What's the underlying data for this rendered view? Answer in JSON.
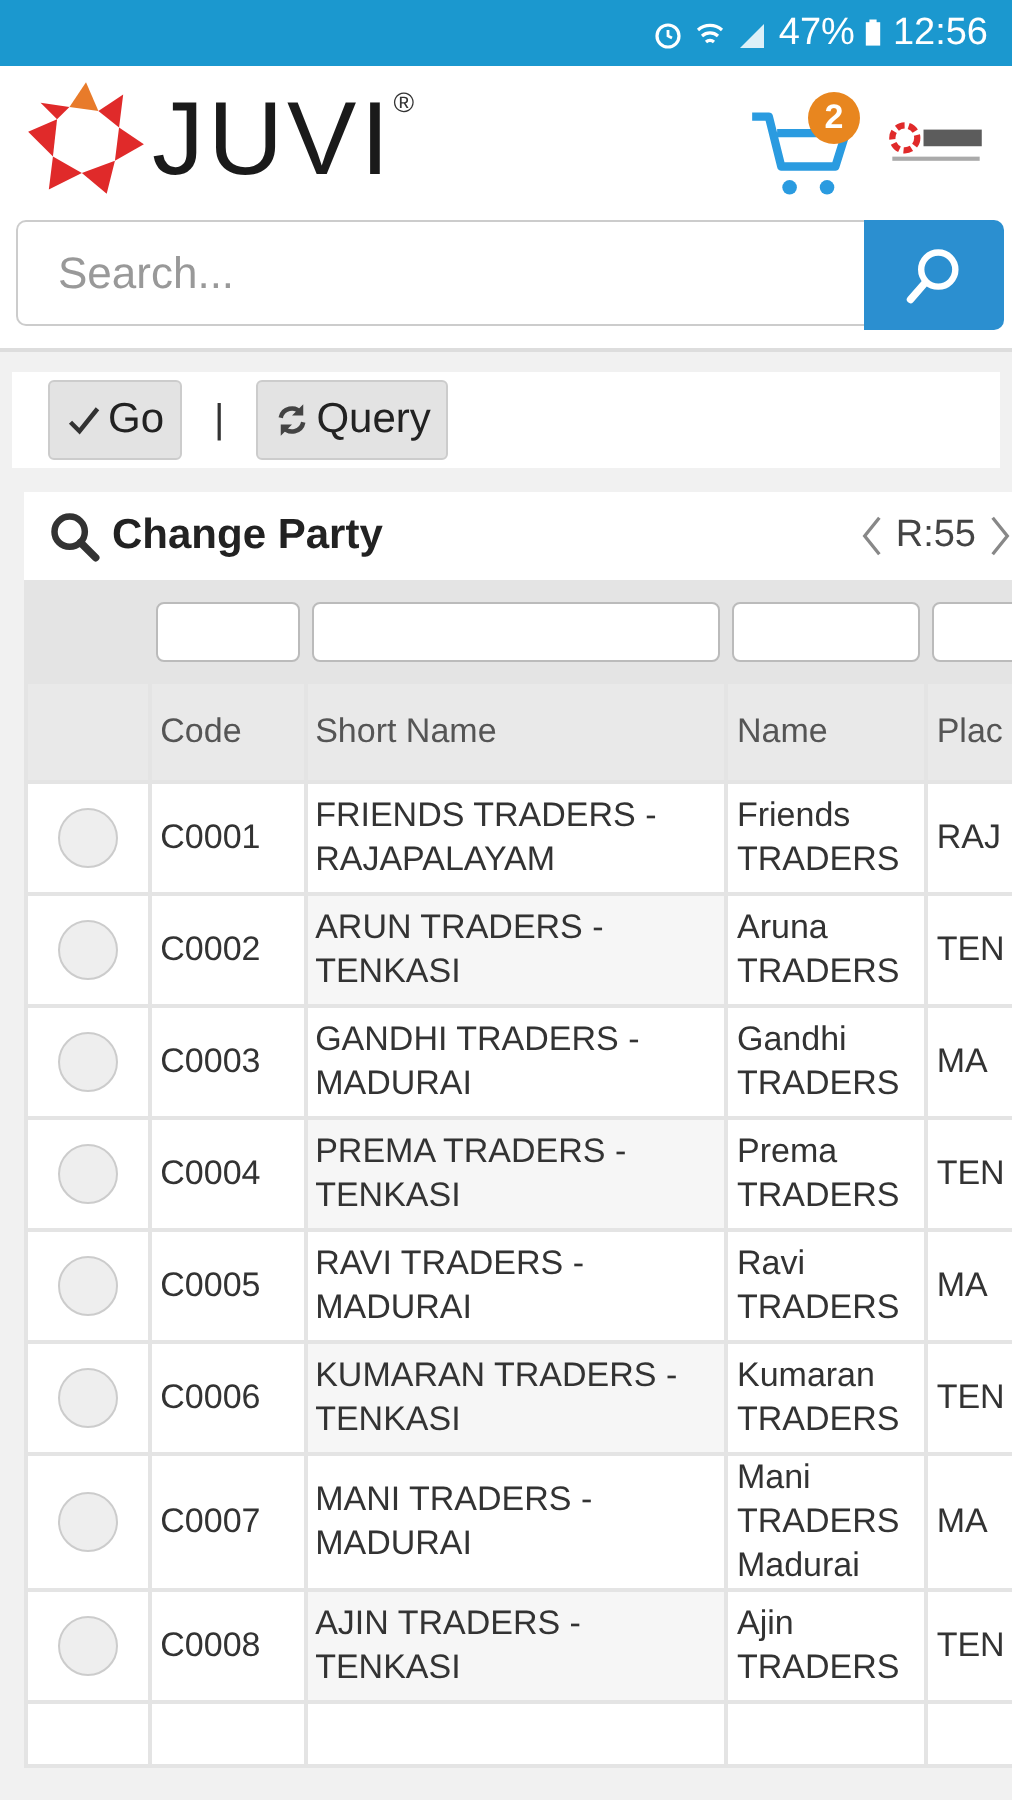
{
  "status_bar": {
    "battery": "47%",
    "time": "12:56"
  },
  "header": {
    "logo_text": "JUVI",
    "logo_mark": "®",
    "cart_count": "2"
  },
  "search": {
    "placeholder": "Search..."
  },
  "toolbar": {
    "buttons": [
      {
        "kind": "go",
        "label": "Go"
      },
      {
        "kind": "query",
        "label": "Query"
      }
    ],
    "separator": "|"
  },
  "panel": {
    "title": "Change Party",
    "record_count": "R:55"
  },
  "table": {
    "columns": [
      "Code",
      "Short Name",
      "Name",
      "Plac"
    ],
    "rows": [
      {
        "selected": false,
        "cells": [
          "C0001",
          "FRIENDS TRADERS - RAJAPALAYAM",
          "Friends TRADERS",
          "RAJ"
        ]
      },
      {
        "selected": false,
        "cells": [
          "C0002",
          "ARUN TRADERS - TENKASI",
          "Aruna TRADERS",
          "TEN"
        ]
      },
      {
        "selected": false,
        "cells": [
          "C0003",
          "GANDHI TRADERS - MADURAI",
          "Gandhi TRADERS",
          "MA"
        ]
      },
      {
        "selected": false,
        "cells": [
          "C0004",
          "PREMA TRADERS - TENKASI",
          "Prema TRADERS",
          "TEN"
        ]
      },
      {
        "selected": false,
        "cells": [
          "C0005",
          "RAVI TRADERS - MADURAI",
          "Ravi TRADERS",
          "MA"
        ]
      },
      {
        "selected": false,
        "cells": [
          "C0006",
          "KUMARAN TRADERS - TENKASI",
          "Kumaran TRADERS",
          "TEN"
        ]
      },
      {
        "selected": false,
        "cells": [
          "C0007",
          "MANI TRADERS - MADURAI",
          "Mani TRADERS Madurai",
          "MA"
        ]
      },
      {
        "selected": false,
        "cells": [
          "C0008",
          "AJIN TRADERS - TENKASI",
          "Ajin TRADERS",
          "TEN"
        ]
      }
    ]
  }
}
